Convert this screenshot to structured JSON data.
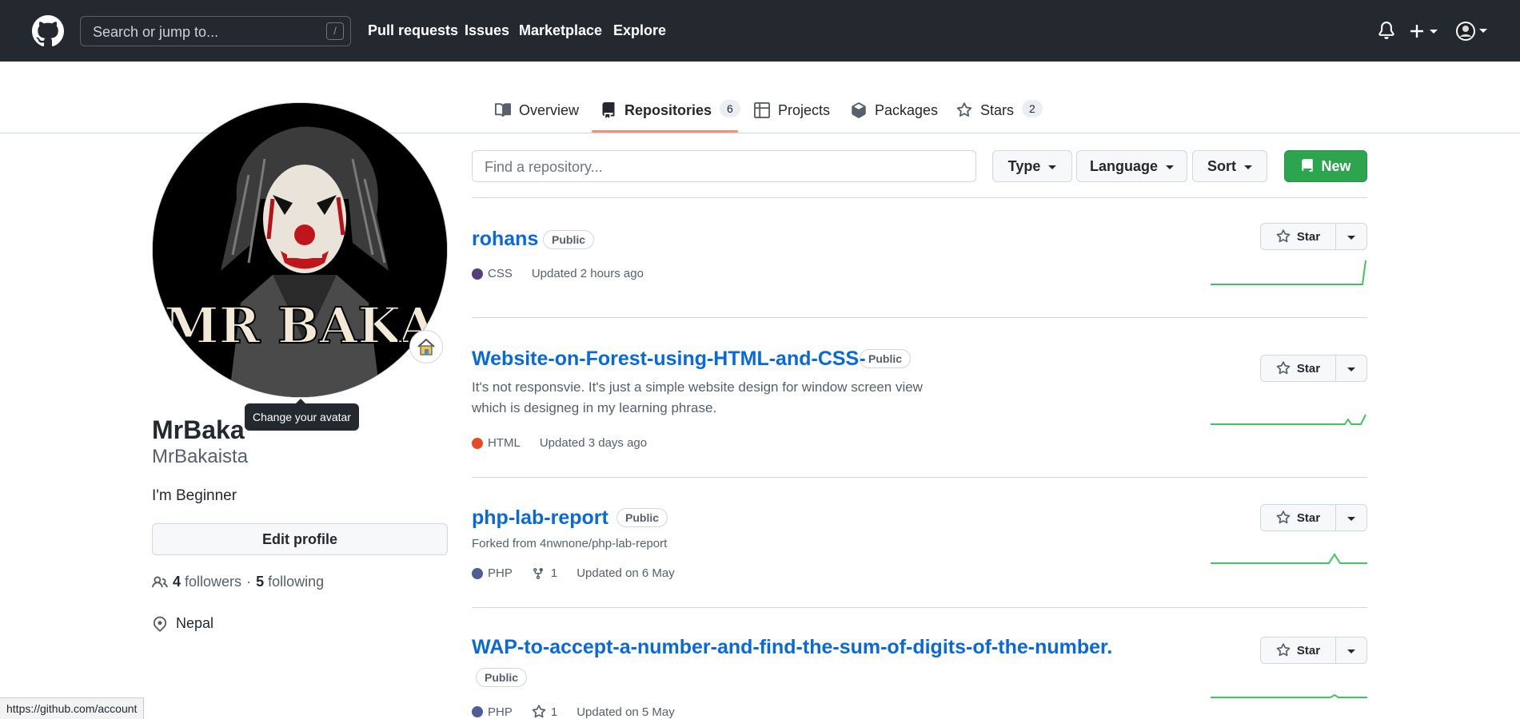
{
  "header": {
    "search_placeholder": "Search or jump to...",
    "search_shortcut": "/",
    "nav": [
      "Pull requests",
      "Issues",
      "Marketplace",
      "Explore"
    ]
  },
  "tabs": [
    {
      "label": "Overview",
      "icon": "book-icon"
    },
    {
      "label": "Repositories",
      "count": "6",
      "icon": "repo-icon",
      "selected": true
    },
    {
      "label": "Projects",
      "icon": "table-icon"
    },
    {
      "label": "Packages",
      "icon": "package-icon"
    },
    {
      "label": "Stars",
      "count": "2",
      "icon": "star-icon"
    }
  ],
  "profile": {
    "avatar_text": "MR BAKA",
    "tooltip": "Change your avatar",
    "name": "MrBaka",
    "username": "MrBakaista",
    "bio": "I'm Beginner",
    "edit_label": "Edit profile",
    "followers_count": "4",
    "followers_label": "followers",
    "separator": "·",
    "following_count": "5",
    "following_label": "following",
    "location": "Nepal"
  },
  "filters": {
    "find_placeholder": "Find a repository...",
    "type_label": "Type",
    "language_label": "Language",
    "sort_label": "Sort",
    "new_label": "New"
  },
  "repos": [
    {
      "name": "rohans",
      "visibility": "Public",
      "language": "CSS",
      "lang_color": "#563d7c",
      "updated": "Updated 2 hours ago"
    },
    {
      "name": "Website-on-Forest-using-HTML-and-CSS-",
      "visibility": "Public",
      "description_line1": "It's not responsvie. It's just a simple website design for window screen view",
      "description_line2": "which is designeg in my learning phrase.",
      "language": "HTML",
      "lang_color": "#e34c26",
      "updated": "Updated 3 days ago"
    },
    {
      "name": "php-lab-report",
      "visibility": "Public",
      "forked_from": "Forked from 4nwnone/php-lab-report",
      "language": "PHP",
      "lang_color": "#4f5d95",
      "forks": "1",
      "updated": "Updated on 6 May"
    },
    {
      "name": "WAP-to-accept-a-number-and-find-the-sum-of-digits-of-the-number.",
      "visibility": "Public",
      "language": "PHP",
      "lang_color": "#4f5d95",
      "stars": "1",
      "updated": "Updated on 5 May"
    }
  ],
  "star_label": "Star",
  "status_url": "https://github.com/account"
}
